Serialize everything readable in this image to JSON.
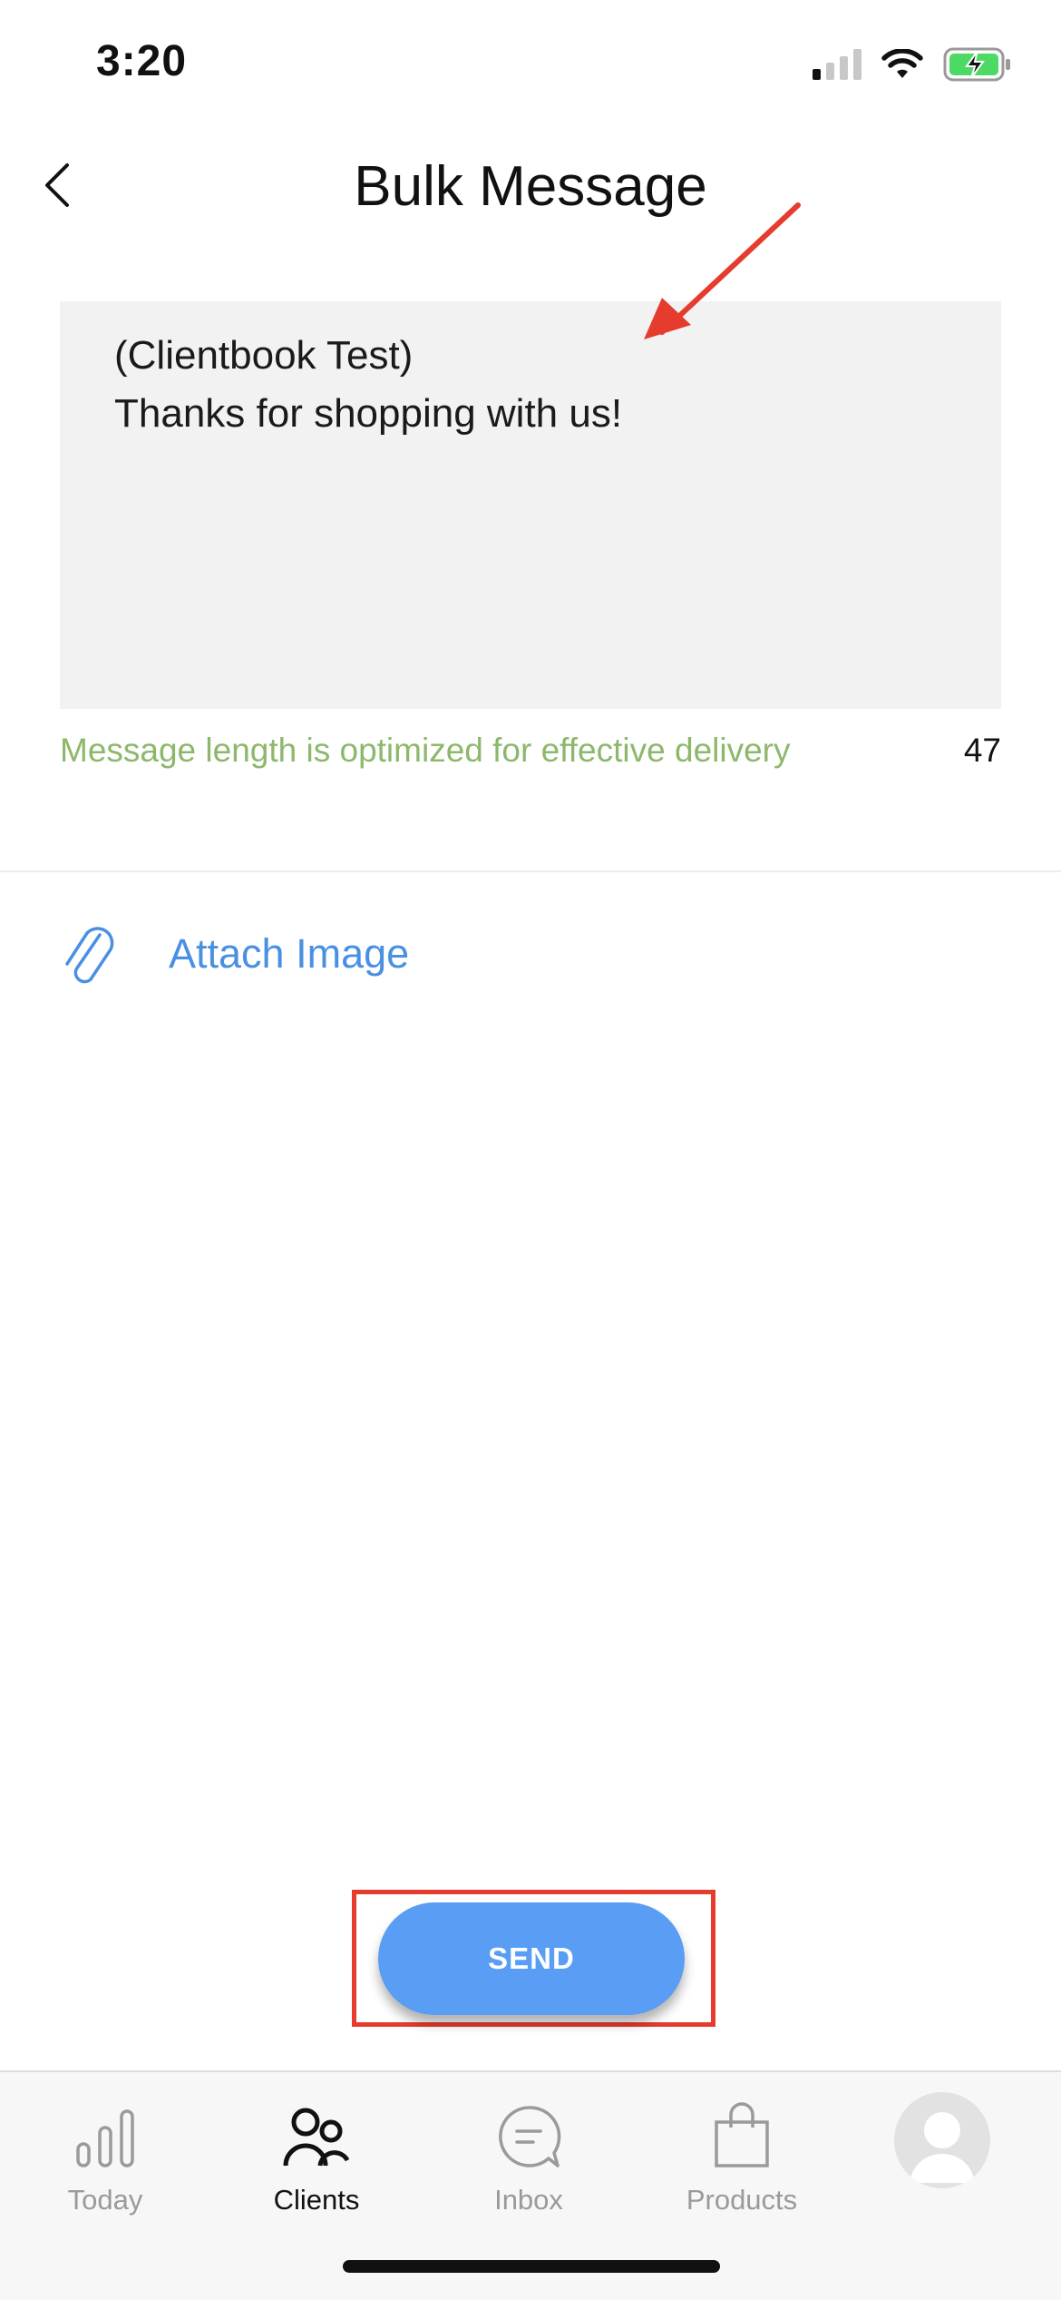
{
  "status_bar": {
    "time": "3:20"
  },
  "header": {
    "title": "Bulk Message"
  },
  "message": {
    "text": "(Clientbook Test)\nThanks for shopping with us!",
    "hint": "Message length is optimized for effective delivery",
    "char_count": "47"
  },
  "attach": {
    "label": "Attach Image"
  },
  "send": {
    "label": "SEND"
  },
  "tabs": [
    {
      "label": "Today",
      "icon": "bar-chart-icon",
      "active": false
    },
    {
      "label": "Clients",
      "icon": "people-icon",
      "active": true
    },
    {
      "label": "Inbox",
      "icon": "chat-bubble-icon",
      "active": false
    },
    {
      "label": "Products",
      "icon": "shopping-bag-icon",
      "active": false
    }
  ],
  "colors": {
    "accent_blue": "#5a9df4",
    "link_blue": "#4a90e2",
    "hint_green": "#8db86b",
    "annotation_red": "#e53c2e",
    "battery_green": "#4cd964"
  }
}
